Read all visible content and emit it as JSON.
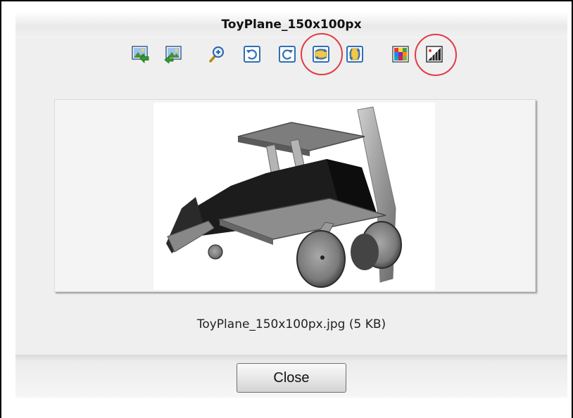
{
  "dialog": {
    "title": "ToyPlane_150x100px",
    "caption": "ToyPlane_150x100px.jpg (5 KB)",
    "close_label": "Close"
  },
  "toolbar": {
    "icons": [
      "insert-image-icon",
      "replace-image-icon",
      "zoom-icon",
      "rotate-left-icon",
      "rotate-right-icon",
      "flip-horizontal-icon",
      "flip-vertical-icon",
      "color-adjust-icon",
      "image-properties-icon"
    ],
    "highlighted": [
      "flip-horizontal-icon",
      "image-properties-icon"
    ]
  },
  "image": {
    "subject": "toy-plane-photo"
  },
  "colors": {
    "highlight_ring": "#e23a44",
    "dialog_background": "#efefef"
  }
}
